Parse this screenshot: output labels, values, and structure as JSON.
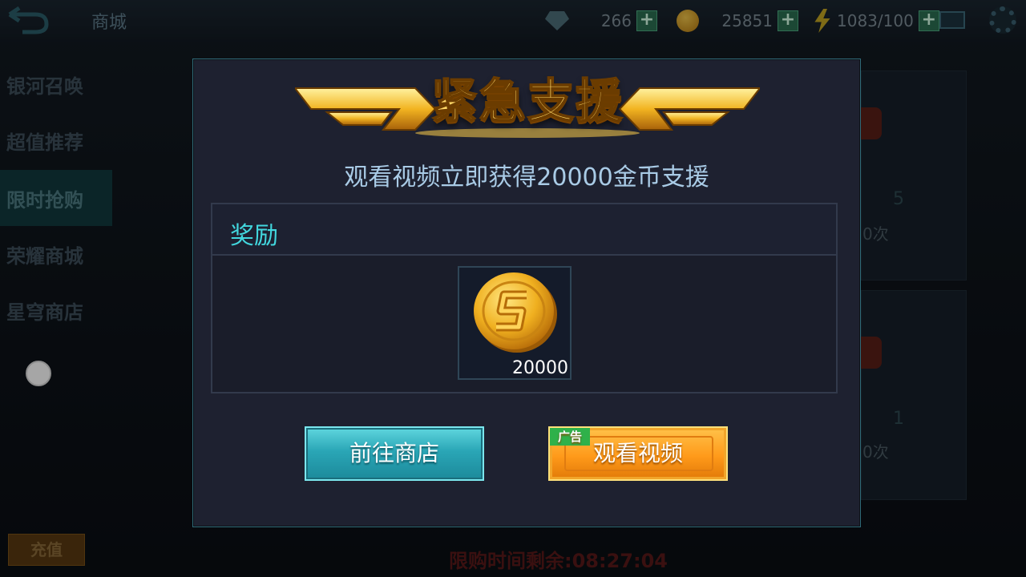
{
  "topbar": {
    "title": "商城",
    "gems": "266",
    "coins": "25851",
    "energy": "1083/100"
  },
  "left_nav": {
    "items": [
      {
        "label": "银河召唤"
      },
      {
        "label": "超值推荐"
      },
      {
        "label": "限时抢购"
      },
      {
        "label": "荣耀商城"
      },
      {
        "label": "星穹商店"
      }
    ],
    "recharge": "充值"
  },
  "background": {
    "limit_timer": "限购时间剩余:08:27:04",
    "cards": [
      {
        "count": "5",
        "label": "0次"
      },
      {
        "count": "1",
        "label": "0次"
      }
    ]
  },
  "dialog": {
    "banner_title": "紧急支援",
    "subtitle": "观看视频立即获得20000金币支援",
    "reward_header": "奖励",
    "reward_item": {
      "icon": "gold-coin-icon",
      "quantity": "20000"
    },
    "btn_store": "前往商店",
    "btn_watch": "观看视频",
    "ad_badge": "广告"
  },
  "colors": {
    "reward_label": "#42d7de",
    "subtitle": "#a9cbe6",
    "store_button": "#2aa6b6",
    "watch_button": "#ff9a1a",
    "ad_badge": "#2fb14a"
  }
}
